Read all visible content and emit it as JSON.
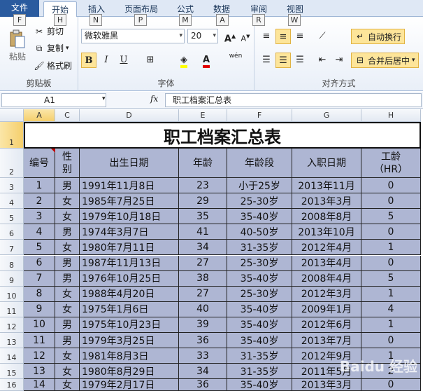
{
  "ribbon_tabs": {
    "file": "文件",
    "home": "开始",
    "insert": "插入",
    "page_layout": "页面布局",
    "formulas": "公式",
    "data": "数据",
    "review": "审阅",
    "view": "视图"
  },
  "keytips": [
    "F",
    "H",
    "N",
    "P",
    "M",
    "A",
    "R",
    "W"
  ],
  "clipboard": {
    "paste": "粘贴",
    "cut": "剪切",
    "copy": "复制",
    "format_painter": "格式刷",
    "group_label": "剪贴板"
  },
  "font": {
    "family": "微软雅黑",
    "size": "20",
    "bold": "B",
    "italic": "I",
    "underline": "U",
    "grow": "A",
    "shrink": "A",
    "phonetic": "wén",
    "group_label": "字体"
  },
  "alignment": {
    "wrap_text": "自动换行",
    "merge_center": "合并后居中",
    "group_label": "对齐方式"
  },
  "formula_bar": {
    "name_box": "A1",
    "fx": "fx",
    "content": "职工档案汇总表"
  },
  "columns": [
    "A",
    "C",
    "D",
    "E",
    "F",
    "G",
    "H"
  ],
  "row_numbers": [
    "1",
    "2",
    "3",
    "4",
    "5",
    "6",
    "7",
    "8",
    "9",
    "10",
    "11",
    "12",
    "13",
    "14",
    "15",
    "16"
  ],
  "sheet": {
    "title": "职工档案汇总表",
    "headers": {
      "id": "编号",
      "gender_1": "性",
      "gender_2": "别",
      "birth": "出生日期",
      "age": "年龄",
      "age_band": "年龄段",
      "hire": "入职日期",
      "tenure_1": "工龄",
      "tenure_2": "（HR）"
    },
    "rows": [
      [
        "1",
        "男",
        "1991年11月8日",
        "23",
        "小于25岁",
        "2013年11月",
        "0"
      ],
      [
        "2",
        "女",
        "1985年7月25日",
        "29",
        "25-30岁",
        "2013年3月",
        "0"
      ],
      [
        "3",
        "女",
        "1979年10月18日",
        "35",
        "35-40岁",
        "2008年8月",
        "5"
      ],
      [
        "4",
        "男",
        "1974年3月7日",
        "41",
        "40-50岁",
        "2013年10月",
        "0"
      ],
      [
        "5",
        "女",
        "1980年7月11日",
        "34",
        "31-35岁",
        "2012年4月",
        "1"
      ],
      [
        "6",
        "男",
        "1987年11月13日",
        "27",
        "25-30岁",
        "2013年4月",
        "0"
      ],
      [
        "7",
        "男",
        "1976年10月25日",
        "38",
        "35-40岁",
        "2008年4月",
        "5"
      ],
      [
        "8",
        "女",
        "1988年4月20日",
        "27",
        "25-30岁",
        "2012年3月",
        "1"
      ],
      [
        "9",
        "女",
        "1975年1月6日",
        "40",
        "35-40岁",
        "2009年1月",
        "4"
      ],
      [
        "10",
        "男",
        "1975年10月23日",
        "39",
        "35-40岁",
        "2012年6月",
        "1"
      ],
      [
        "11",
        "男",
        "1979年3月25日",
        "36",
        "35-40岁",
        "2013年7月",
        "0"
      ],
      [
        "12",
        "女",
        "1981年8月3日",
        "33",
        "31-35岁",
        "2012年9月",
        "1"
      ],
      [
        "13",
        "女",
        "1980年8月29日",
        "34",
        "31-35岁",
        "2011年5月",
        "2"
      ],
      [
        "14",
        "女",
        "1979年2月17日",
        "36",
        "35-40岁",
        "2013年3月",
        "0"
      ]
    ]
  },
  "watermark": "Baidu 经验"
}
